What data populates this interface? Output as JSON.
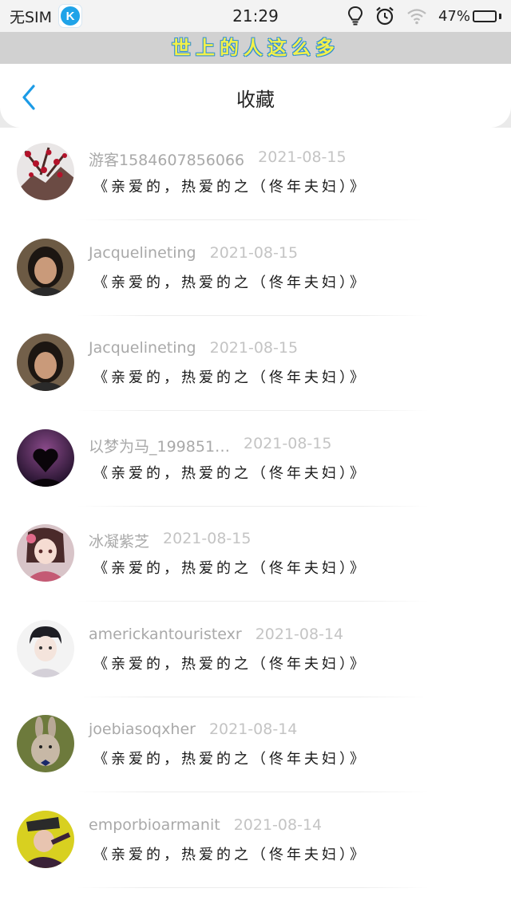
{
  "status_bar": {
    "carrier": "无SIM",
    "time": "21:29",
    "battery": "47%",
    "battery_level": 0.47,
    "icons": [
      "k-app-icon",
      "lightbulb-icon",
      "alarm-icon",
      "wifi-icon",
      "battery-icon"
    ]
  },
  "banner": {
    "text": "世上的人这么多"
  },
  "header": {
    "title": "收藏",
    "back_icon": "chevron-left-icon"
  },
  "colors": {
    "accent": "#1c9be6",
    "banner_text": "#f2f04b",
    "banner_bg": "#d1d1d1"
  },
  "items": [
    {
      "username": "游客1584607856066",
      "date": "2021-08-15",
      "text": "《亲爱的，热爱的之（佟年夫妇）》"
    },
    {
      "username": "Jacquelineting",
      "date": "2021-08-15",
      "text": "《亲爱的，热爱的之（佟年夫妇）》"
    },
    {
      "username": "Jacquelineting",
      "date": "2021-08-15",
      "text": "《亲爱的，热爱的之（佟年夫妇）》"
    },
    {
      "username": "以梦为马_199851…",
      "date": "2021-08-15",
      "text": "《亲爱的，热爱的之（佟年夫妇）》"
    },
    {
      "username": "冰凝紫芝",
      "date": "2021-08-15",
      "text": "《亲爱的，热爱的之（佟年夫妇）》"
    },
    {
      "username": "americkantouristexr",
      "date": "2021-08-14",
      "text": "《亲爱的，热爱的之（佟年夫妇）》"
    },
    {
      "username": "joebiasoqxher",
      "date": "2021-08-14",
      "text": "《亲爱的，热爱的之（佟年夫妇）》"
    },
    {
      "username": "emporbioarmanit",
      "date": "2021-08-14",
      "text": "《亲爱的，热爱的之（佟年夫妇）》"
    }
  ]
}
